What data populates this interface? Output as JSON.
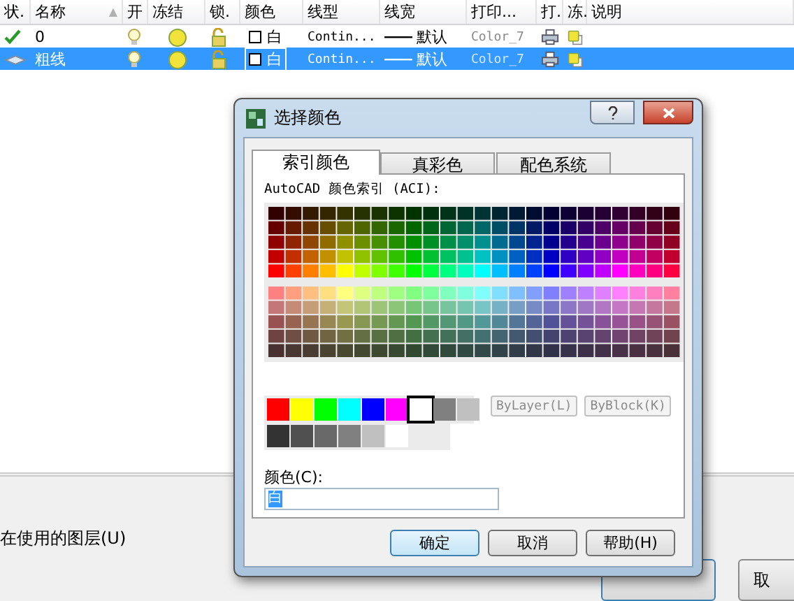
{
  "layer_table": {
    "columns": [
      {
        "label": "状."
      },
      {
        "label": "名称",
        "sort_arrow": "▲"
      },
      {
        "label": "开"
      },
      {
        "label": "冻结"
      },
      {
        "label": "锁."
      },
      {
        "label": "颜色"
      },
      {
        "label": "线型"
      },
      {
        "label": "线宽"
      },
      {
        "label": "打印..."
      },
      {
        "label": "打."
      },
      {
        "label": "冻."
      },
      {
        "label": "说明"
      }
    ],
    "rows": [
      {
        "kind": "current",
        "name": "0",
        "selected": false,
        "color_name": "白",
        "linetype": "Contin...",
        "lineweight": "默认",
        "plot_style": "Color_7"
      },
      {
        "kind": "layer",
        "name": "粗线",
        "selected": true,
        "color_name": "白",
        "linetype": "Contin...",
        "lineweight": "默认",
        "plot_style": "Color_7"
      }
    ]
  },
  "bottom_panel": {
    "option_label": "在使用的图层(U)",
    "buttons": [
      {
        "default": true
      },
      {
        "label": "取",
        "default": false
      }
    ]
  },
  "dialog": {
    "title": "选择颜色",
    "tabs": [
      {
        "label": "索引颜色",
        "selected": true
      },
      {
        "label": "真彩色",
        "selected": false
      },
      {
        "label": "配色系统",
        "selected": false
      }
    ],
    "palette_label": "AutoCAD 颜色索引 (ACI):",
    "standard_colors": [
      {
        "color": "#ff0000",
        "selected": false
      },
      {
        "color": "#ffff00",
        "selected": false
      },
      {
        "color": "#00ff00",
        "selected": false
      },
      {
        "color": "#00ffff",
        "selected": false
      },
      {
        "color": "#0000ff",
        "selected": false
      },
      {
        "color": "#ff00ff",
        "selected": false
      },
      {
        "color": "#ffffff",
        "selected": true
      },
      {
        "color": "#808080",
        "selected": false
      },
      {
        "color": "#c0c0c0",
        "selected": false
      }
    ],
    "gray_colors": [
      {
        "color": "#333333",
        "selected": false
      },
      {
        "color": "#505050",
        "selected": false
      },
      {
        "color": "#696969",
        "selected": false
      },
      {
        "color": "#808080",
        "selected": false
      },
      {
        "color": "#c0c0c0",
        "selected": false
      },
      {
        "color": "#ffffff",
        "selected": false
      }
    ],
    "bylayer_button": "ByLayer(L)",
    "byblock_button": "ByBlock(K)",
    "color_field_label": "颜色(C):",
    "color_field_value": "白",
    "buttons": [
      {
        "label": "确定",
        "default": true
      },
      {
        "label": "取消",
        "default": false
      },
      {
        "label": "帮助(H)",
        "default": false
      }
    ]
  }
}
